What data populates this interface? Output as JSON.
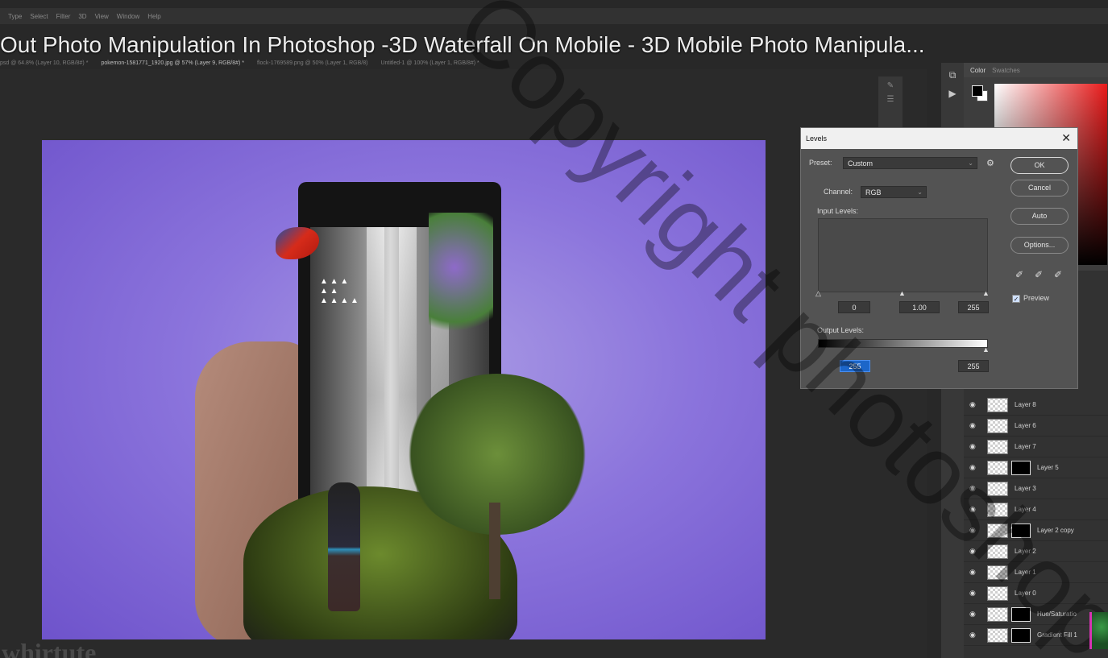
{
  "menu": [
    "Type",
    "Select",
    "Filter",
    "3D",
    "View",
    "Window",
    "Help"
  ],
  "video_title": "Out Photo Manipulation In Photoshop -3D Waterfall On Mobile - 3D Mobile Photo Manipula...",
  "tabs": [
    {
      "label": "psd @ 64.8% (Layer 10, RGB/8#) *"
    },
    {
      "label": "pokemon-1581771_1920.jpg @ 57% (Layer 9, RGB/8#) *"
    },
    {
      "label": "flock-1769589.png @ 50% (Layer 1, RGB/8)"
    },
    {
      "label": "Untitled-1 @ 100% (Layer 1, RGB/8#) *"
    }
  ],
  "panel_tabs": {
    "color": "Color",
    "swatches": "Swatches"
  },
  "dialog": {
    "title": "Levels",
    "preset_label": "Preset:",
    "preset_value": "Custom",
    "channel_label": "Channel:",
    "channel_value": "RGB",
    "input_levels_label": "Input Levels:",
    "input_black": "0",
    "input_gamma": "1.00",
    "input_white": "255",
    "output_levels_label": "Output Levels:",
    "output_black": "255",
    "output_white": "255",
    "buttons": {
      "ok": "OK",
      "cancel": "Cancel",
      "auto": "Auto",
      "options": "Options..."
    },
    "preview_label": "Preview"
  },
  "layers": [
    {
      "name": "Layer 8",
      "mask": false
    },
    {
      "name": "Layer 6",
      "mask": false
    },
    {
      "name": "Layer 7",
      "mask": false
    },
    {
      "name": "Layer 5",
      "mask": true
    },
    {
      "name": "Layer 3",
      "mask": false
    },
    {
      "name": "Layer 4",
      "mask": false
    },
    {
      "name": "Layer 2 copy",
      "mask": true
    },
    {
      "name": "Layer 2",
      "mask": false
    },
    {
      "name": "Layer 1",
      "mask": false
    },
    {
      "name": "Layer 0",
      "mask": false
    },
    {
      "name": "Hue/Saturatio",
      "mask": true
    },
    {
      "name": "Gradient Fill 1",
      "mask": true
    }
  ],
  "watermark_text": "Copyright photoshop",
  "bottom_text": "whirtute"
}
